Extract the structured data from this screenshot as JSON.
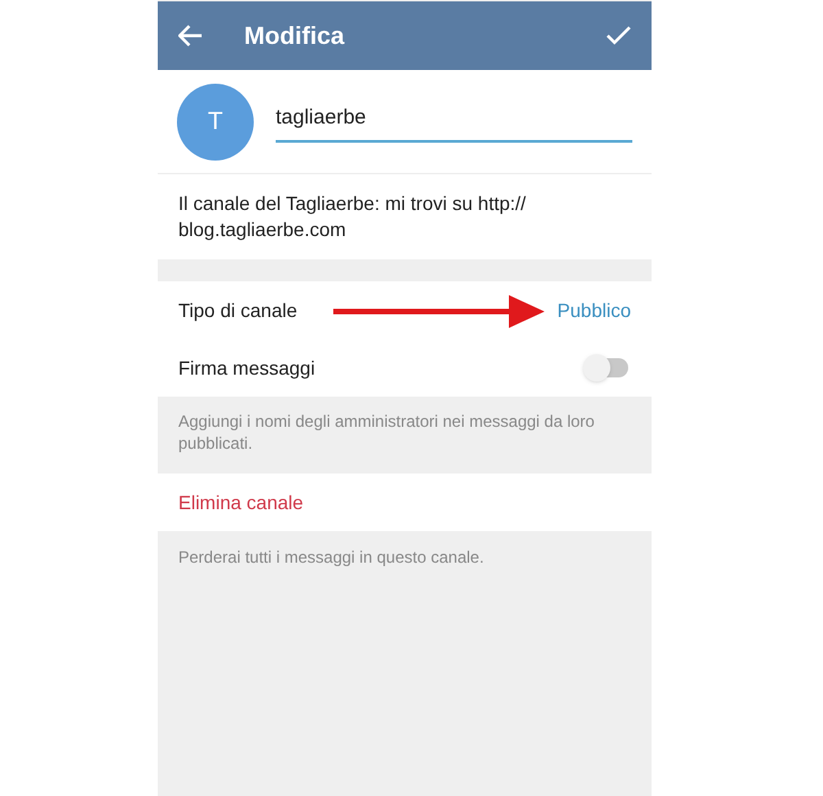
{
  "header": {
    "title": "Modifica"
  },
  "channel": {
    "avatar_letter": "T",
    "name": "tagliaerbe",
    "description": "Il canale del Tagliaerbe: mi trovi su http:// blog.tagliaerbe.com"
  },
  "settings": [
    {
      "kind": "value",
      "label": "Tipo di canale",
      "value": "Pubblico",
      "annotated": true
    },
    {
      "kind": "toggle",
      "label": "Firma messaggi",
      "on": false
    }
  ],
  "sign_hint": "Aggiungi i nomi degli amministratori nei messaggi da loro pubblicati.",
  "delete": {
    "label": "Elimina canale",
    "hint": "Perderai tutti i messaggi in questo canale."
  }
}
